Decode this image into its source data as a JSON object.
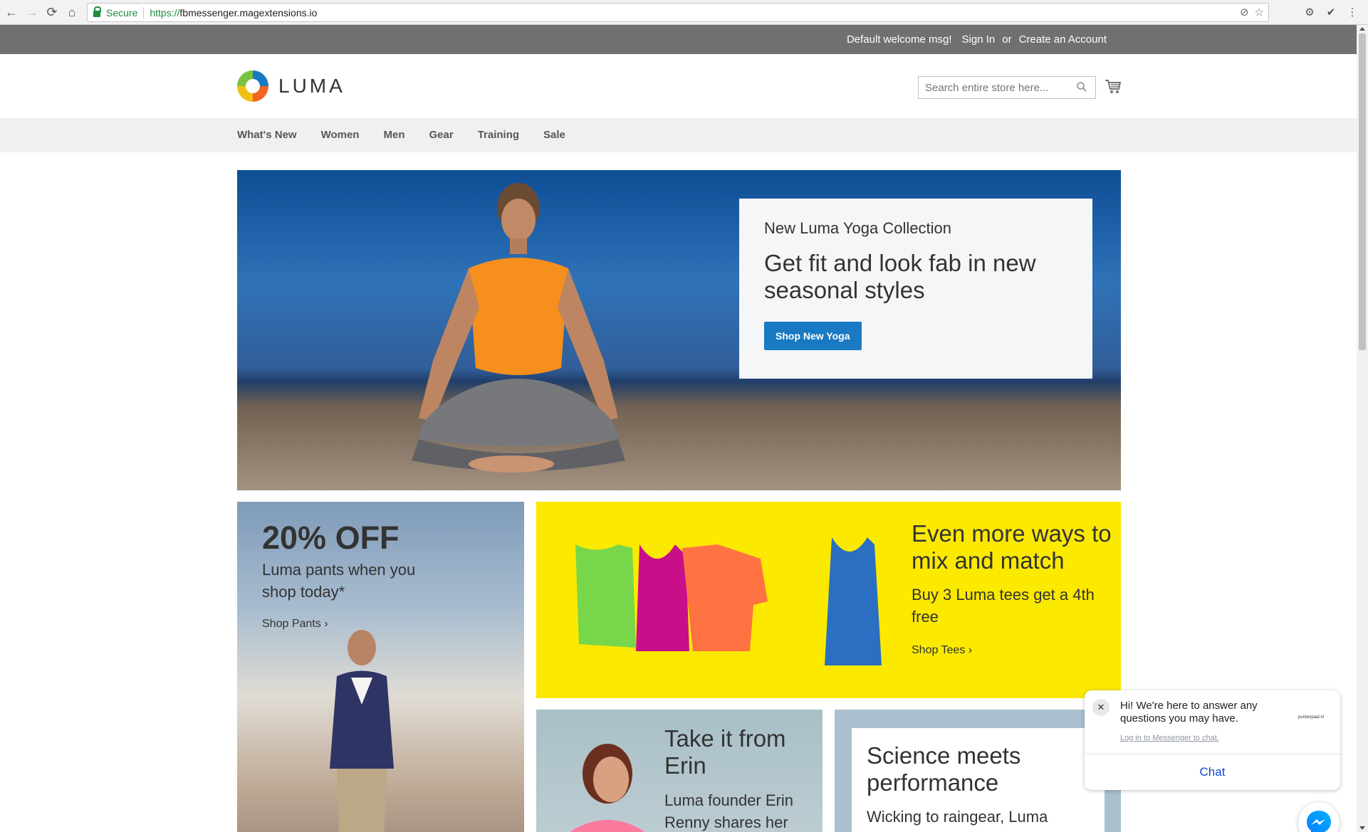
{
  "browser": {
    "secure_label": "Secure",
    "url_scheme": "https://",
    "url_host": "fbmessenger.magextensions.io"
  },
  "panel": {
    "welcome": "Default welcome msg!",
    "sign_in": "Sign In",
    "or": "or",
    "create_account": "Create an Account"
  },
  "header": {
    "logo_text": "LUMA",
    "search_placeholder": "Search entire store here..."
  },
  "nav": {
    "items": [
      "What's New",
      "Women",
      "Men",
      "Gear",
      "Training",
      "Sale"
    ]
  },
  "hero": {
    "subtitle": "New Luma Yoga Collection",
    "title": "Get fit and look fab in new seasonal styles",
    "button": "Shop New Yoga"
  },
  "pants_promo": {
    "heading": "20% OFF",
    "text": "Luma pants when you shop today*",
    "link": "Shop Pants"
  },
  "tees_promo": {
    "heading": "Even more ways to mix and match",
    "text": "Buy 3 Luma tees get a 4th free",
    "link": "Shop Tees"
  },
  "erin_promo": {
    "heading": "Take it from Erin",
    "text": "Luma founder Erin Renny shares her"
  },
  "science_promo": {
    "heading": "Science meets performance",
    "text": "Wicking to raingear, Luma"
  },
  "chat": {
    "close": "✕",
    "message": "Hi! We're here to answer any questions you may have.",
    "login_link": "Log in to Messenger to chat.",
    "brand": "puntenpaal.nl",
    "button": "Chat"
  },
  "colors": {
    "accent": "#1979c3",
    "panel_bg": "#6e716e",
    "nav_bg": "#f0f0f0",
    "tees_bg": "#fbe900",
    "messenger_blue": "#0a7cff"
  },
  "icons": [
    "back-icon",
    "forward-icon",
    "reload-icon",
    "home-icon",
    "lock-icon",
    "star-icon",
    "search-icon",
    "cart-icon",
    "messenger-icon"
  ]
}
